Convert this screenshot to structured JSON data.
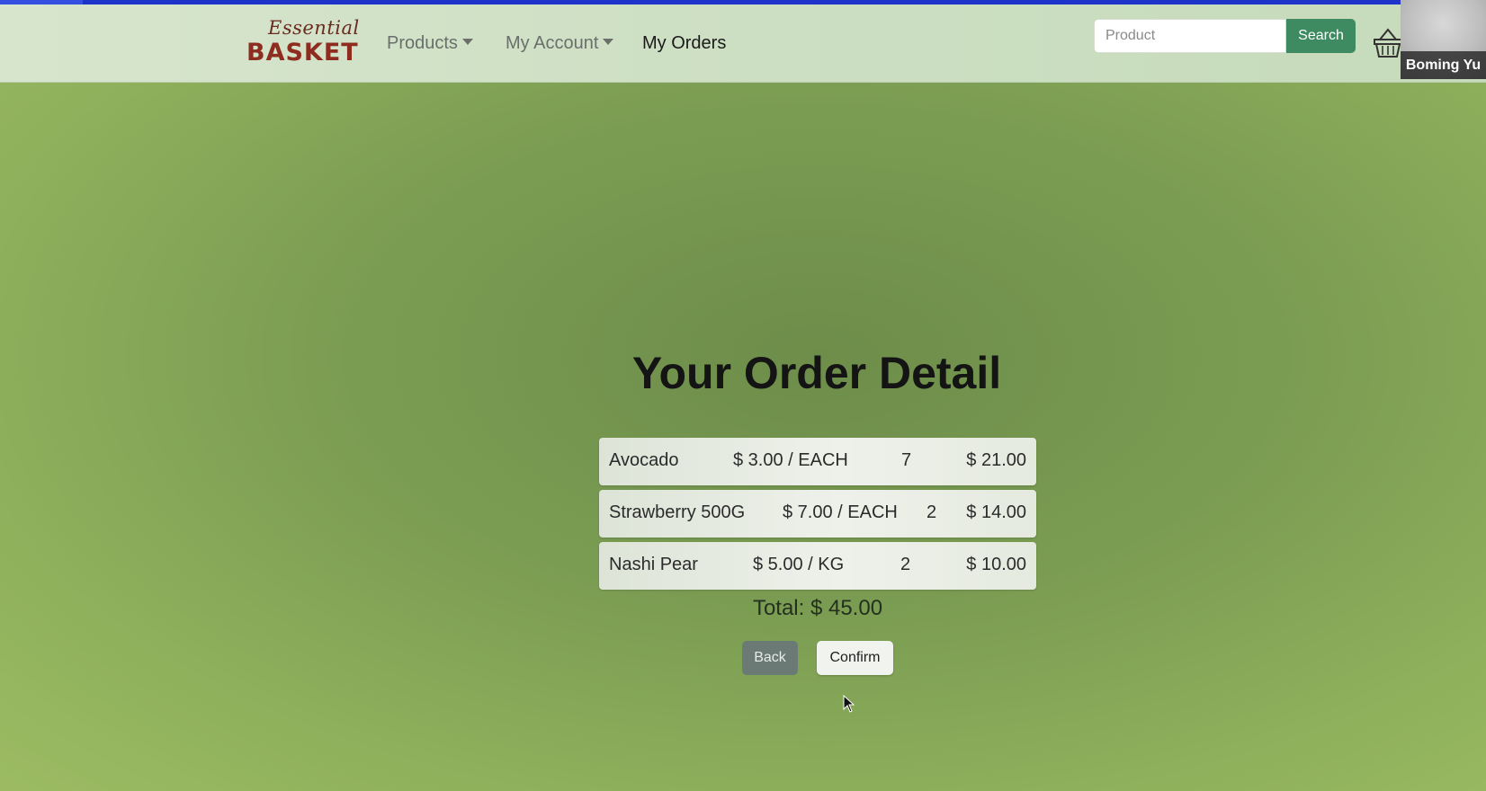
{
  "brand": {
    "script": "Essential",
    "word": "BASKET"
  },
  "nav": {
    "products": "Products",
    "my_account": "My Account",
    "my_orders": "My Orders"
  },
  "search": {
    "placeholder": "Product",
    "button_label": "Search"
  },
  "cart": {
    "icon": "basket-icon"
  },
  "video": {
    "participant_name": "Boming Yu"
  },
  "page": {
    "title": "Your Order Detail"
  },
  "order": {
    "items": [
      {
        "name": "Avocado",
        "price": "$ 3.00 / EACH",
        "qty": "7",
        "total": "$ 21.00"
      },
      {
        "name": "Strawberry 500G",
        "price": "$ 7.00 / EACH",
        "qty": "2",
        "total": "$ 14.00"
      },
      {
        "name": "Nashi Pear",
        "price": "$ 5.00 / KG",
        "qty": "2",
        "total": "$ 10.00"
      }
    ],
    "total_label": "Total: $ 45.00"
  },
  "actions": {
    "back": "Back",
    "confirm": "Confirm"
  },
  "colors": {
    "top_strip": "#1e33c9",
    "search_button": "#3e8b62",
    "brand": "#8e2d1f",
    "back_button": "#6b7a75"
  }
}
